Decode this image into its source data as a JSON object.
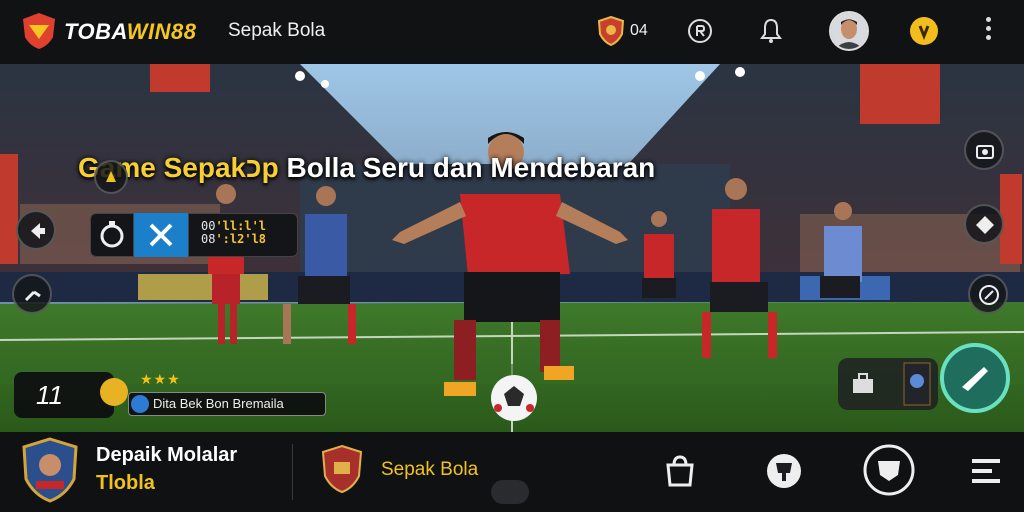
{
  "header": {
    "brand_part1": "TOBA",
    "brand_part2": "WIN88",
    "nav_title": "Sepak Bola",
    "shield_count": "04",
    "icons": [
      "shield-badge-icon",
      "r-coin-icon",
      "bell-icon",
      "avatar",
      "coin-icon",
      "kebab-menu-icon"
    ]
  },
  "hero": {
    "headline_part1": "Game Sepakכp",
    "headline_part2": "Bolla Seru dan Mendebaran"
  },
  "hud": {
    "line1_prefix": "00",
    "line1_value": "'ll:l'l",
    "line2_prefix": "08",
    "line2_value": "':l2'l8"
  },
  "player_card": {
    "number": "11",
    "stars": "★★★",
    "name": "Dita Bek Bon Bremaila"
  },
  "footer": {
    "title": "Depaik Molalar",
    "subtitle": "Tlobla",
    "section_label": "Sepak Bola",
    "icons": [
      "bag-icon",
      "trophy-icon",
      "shield-chat-icon",
      "menu-list-icon"
    ]
  },
  "colors": {
    "accent": "#f2c21c",
    "brand_red": "#e0412f",
    "bar_bg": "#111214",
    "action": "#1f6d5c"
  }
}
